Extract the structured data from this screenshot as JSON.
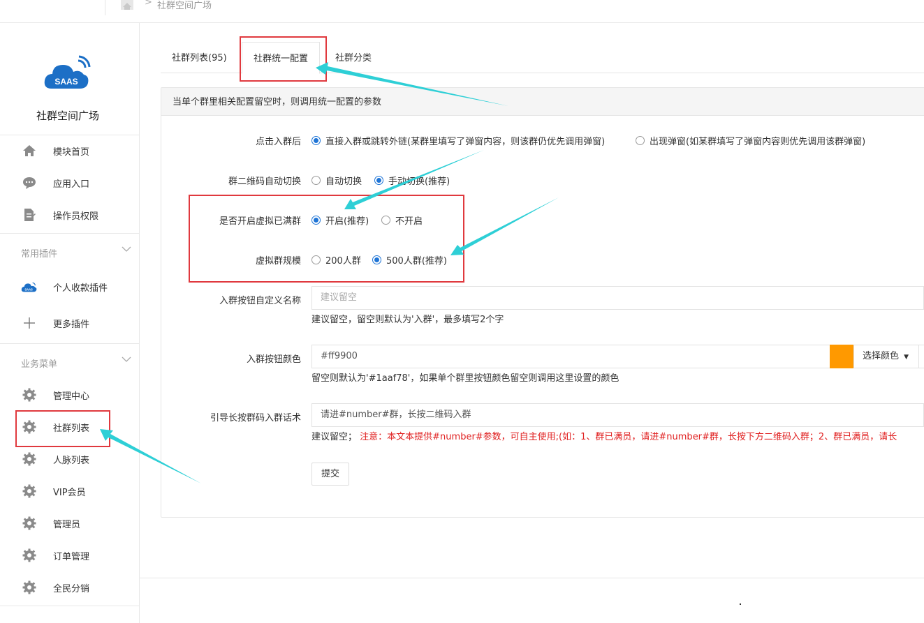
{
  "breadcrumb": {
    "home_icon": "home-icon",
    "separator": ">",
    "current": "社群空间广场"
  },
  "sidebar": {
    "brand": "社群空间广场",
    "logo_text": "SAAS",
    "main_items": [
      {
        "label": "模块首页",
        "icon": "home-icon"
      },
      {
        "label": "应用入口",
        "icon": "chat-bubble-icon"
      },
      {
        "label": "操作员权限",
        "icon": "document-edit-icon"
      }
    ],
    "plugins_group": "常用插件",
    "plugin_items": [
      {
        "label": "个人收款插件",
        "icon": "saas-cloud-icon"
      },
      {
        "label": "更多插件",
        "icon": "plus-icon"
      }
    ],
    "business_group": "业务菜单",
    "business_items": [
      {
        "label": "管理中心",
        "icon": "gear-icon"
      },
      {
        "label": "社群列表",
        "icon": "gear-icon"
      },
      {
        "label": "人脉列表",
        "icon": "gear-icon"
      },
      {
        "label": "VIP会员",
        "icon": "gear-icon"
      },
      {
        "label": "管理员",
        "icon": "gear-icon"
      },
      {
        "label": "订单管理",
        "icon": "gear-icon"
      },
      {
        "label": "全民分销",
        "icon": "gear-icon"
      }
    ]
  },
  "tabs": [
    {
      "label": "社群列表(95)"
    },
    {
      "label": "社群统一配置"
    },
    {
      "label": "社群分类"
    }
  ],
  "panel": {
    "header": "当单个群里相关配置留空时，则调用统一配置的参数",
    "click_join": {
      "label": "点击入群后",
      "option1": "直接入群或跳转外链(某群里填写了弹窗内容，则该群仍优先调用弹窗)",
      "option2": "出现弹窗(如某群填写了弹窗内容则优先调用该群弹窗)"
    },
    "qr_switch": {
      "label": "群二维码自动切换",
      "option1": "自动切换",
      "option2": "手动切换(推荐)"
    },
    "virtual_full": {
      "label": "是否开启虚拟已满群",
      "option1": "开启(推荐)",
      "option2": "不开启"
    },
    "virtual_scale": {
      "label": "虚拟群规模",
      "option1": "200人群",
      "option2": "500人群(推荐)"
    },
    "button_name": {
      "label": "入群按钮自定义名称",
      "placeholder": "建议留空",
      "hint": "建议留空，留空则默认为'入群'，最多填写2个字"
    },
    "button_color": {
      "label": "入群按钮颜色",
      "value": "#ff9900",
      "picker_label": "选择颜色",
      "hint": "留空则默认为'#1aaf78'，如果单个群里按钮颜色留空则调用这里设置的颜色"
    },
    "guide_text": {
      "label": "引导长按群码入群话术",
      "value": "请进#number#群，长按二维码入群",
      "hint_prefix": "建议留空；",
      "hint_red": "注意：本文本提供#number#参数，可自主使用;(如：1、群已满员，请进#number#群，长按下方二维码入群；2、群已满员，请长"
    },
    "submit": "提交"
  },
  "colors": {
    "accent_blue": "#1e74d6",
    "swatch": "#ff9900",
    "annotation_red": "#e0393e",
    "arrow_cyan": "#2ecfd6",
    "hint_red": "#e02020"
  }
}
